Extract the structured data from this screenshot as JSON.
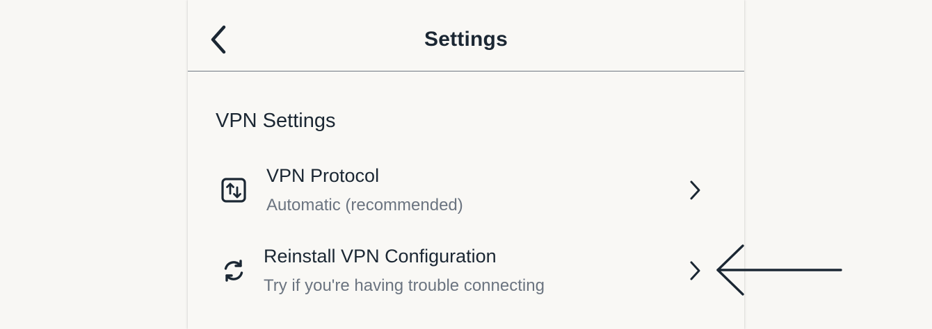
{
  "header": {
    "title": "Settings",
    "back_icon": "chevron-left-icon"
  },
  "section": {
    "title": "VPN Settings"
  },
  "rows": [
    {
      "label": "VPN Protocol",
      "subtitle": "Automatic (recommended)",
      "icon": "protocol-arrows-icon"
    },
    {
      "label": "Reinstall VPN Configuration",
      "subtitle": "Try if you're having trouble connecting",
      "icon": "refresh-icon"
    }
  ],
  "colors": {
    "text": "#1b2733",
    "subtext": "#6b7480",
    "background": "#f9f8f5",
    "divider": "#6e7780"
  }
}
